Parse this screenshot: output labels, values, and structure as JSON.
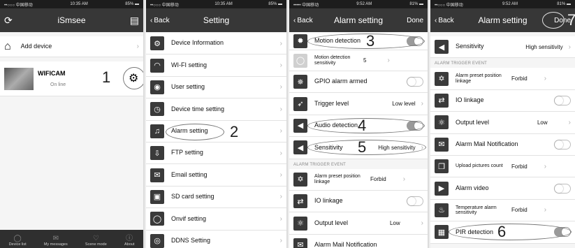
{
  "panel1": {
    "status": {
      "carrier": "••○○○ 中国移动 ",
      "time": "10:35 AM",
      "battery": "85% ▬"
    },
    "title": "iSmsee",
    "refresh_icon": "⟳",
    "menu_icon": "▤",
    "add_device_label": "Add device",
    "camera": {
      "name": "WIFICAM",
      "status": "On line"
    },
    "annotation": "1",
    "tabs": [
      {
        "icon": "◯",
        "label": "Device list"
      },
      {
        "icon": "✉",
        "label": "My messages"
      },
      {
        "icon": "♡",
        "label": "Scene mode"
      },
      {
        "icon": "ⓘ",
        "label": "About"
      }
    ]
  },
  "panel2": {
    "status": {
      "carrier": "••○○○ 中国移动 ",
      "time": "10:35 AM",
      "battery": "85% ▬"
    },
    "back_label": "Back",
    "title": "Setting",
    "annotation": "2",
    "items": [
      {
        "icon": "⚙",
        "label": "Device Information"
      },
      {
        "icon": "◠",
        "label": "WI-FI setting"
      },
      {
        "icon": "◉",
        "label": "User setting"
      },
      {
        "icon": "◷",
        "label": "Device time setting"
      },
      {
        "icon": "♫",
        "label": "Alarm setting"
      },
      {
        "icon": "⇩",
        "label": "FTP setting"
      },
      {
        "icon": "✉",
        "label": "Email setting"
      },
      {
        "icon": "▣",
        "label": "SD card setting"
      },
      {
        "icon": "◯",
        "label": "Onvif setting"
      },
      {
        "icon": "◎",
        "label": "DDNS Setting"
      }
    ]
  },
  "panel3": {
    "status": {
      "carrier": "••••• 中国移动 ",
      "time": "9:52 AM",
      "battery": "81% ▬"
    },
    "back_label": "Back",
    "title": "Alarm setting",
    "done_label": "Done",
    "motion_detection": "Motion detection",
    "motion_sensitivity_label": "Motion detection sensitivity",
    "motion_sensitivity_value": "5",
    "gpio_label": "GPIO alarm armed",
    "trigger_label": "Trigger level",
    "trigger_value": "Low level",
    "audio_label": "Audio detection",
    "sensitivity_label": "Sensitivity",
    "sensitivity_value": "High sensitivity",
    "section": "ALARM TRIGGER EVENT",
    "preset_label": "Alarm preset position linkage",
    "preset_value": "Forbid",
    "io_label": "IO linkage",
    "output_label": "Output level",
    "output_value": "Low",
    "mail_label": "Alarm Mail Notification",
    "annotations": {
      "a3": "3",
      "a4": "4",
      "a5": "5"
    }
  },
  "panel4": {
    "status": {
      "carrier": "••○○○ 中国移动 ",
      "time": "9:52 AM",
      "battery": "81% ▬"
    },
    "back_label": "Back",
    "title": "Alarm setting",
    "done_label": "Done",
    "sensitivity_label": "Sensitivity",
    "sensitivity_value": "High sensitivity",
    "section": "ALARM TRIGGER EVENT",
    "preset_label": "Alarm preset position linkage",
    "preset_value": "Forbid",
    "io_label": "IO linkage",
    "output_label": "Output level",
    "output_value": "Low",
    "mail_label": "Alarm Mail Notification",
    "upload_label": "Upload pictures count",
    "upload_value": "Forbid",
    "video_label": "Alarm video",
    "temp_label": "Temperature alarm sensitivity",
    "temp_value": "Forbid",
    "pir_label": "PIR detection",
    "annotations": {
      "a6": "6",
      "a7": "7"
    }
  }
}
